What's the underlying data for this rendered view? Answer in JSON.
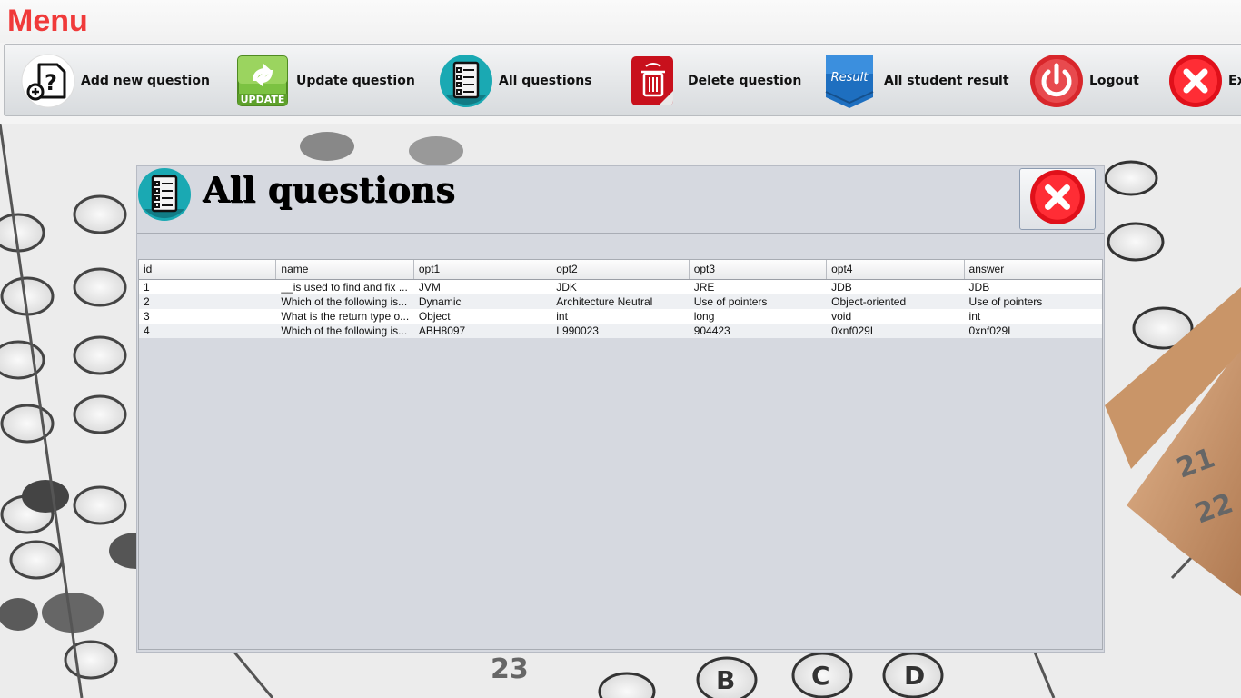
{
  "menu": {
    "title": "Menu"
  },
  "toolbar": {
    "items": [
      {
        "label": "Add new question",
        "icon": "add-question-icon"
      },
      {
        "label": "Update question",
        "icon": "update-icon"
      },
      {
        "label": "All questions",
        "icon": "all-questions-icon"
      },
      {
        "label": "Delete question",
        "icon": "delete-icon"
      },
      {
        "label": "All student result",
        "icon": "result-icon",
        "badge": "Result"
      },
      {
        "label": "Logout",
        "icon": "logout-icon"
      },
      {
        "label": "Exit",
        "icon": "exit-icon"
      }
    ]
  },
  "dialog": {
    "title": "All questions",
    "icon": "all-questions-icon",
    "close_icon": "close-icon"
  },
  "table": {
    "columns": [
      "id",
      "name",
      "opt1",
      "opt2",
      "opt3",
      "opt4",
      "answer"
    ],
    "rows": [
      [
        "1",
        "__is used to find and fix ...",
        "JVM",
        "JDK",
        "JRE",
        "JDB",
        "JDB"
      ],
      [
        "2",
        "Which of the following is...",
        "Dynamic",
        "Architecture Neutral",
        "Use of pointers",
        "Object-oriented",
        "Use of pointers"
      ],
      [
        "3",
        "What is the return type o...",
        "Object",
        "int",
        "long",
        "void",
        "int"
      ],
      [
        "4",
        "Which of the following is...",
        "ABH8097",
        "L990023",
        "904423",
        "0xnf029L",
        "0xnf029L"
      ]
    ]
  },
  "colors": {
    "menu_title": "#f03a3a",
    "dialog_bg": "#d6d9e0",
    "exit_red": "#e0101a",
    "logout_red": "#d8262b"
  }
}
